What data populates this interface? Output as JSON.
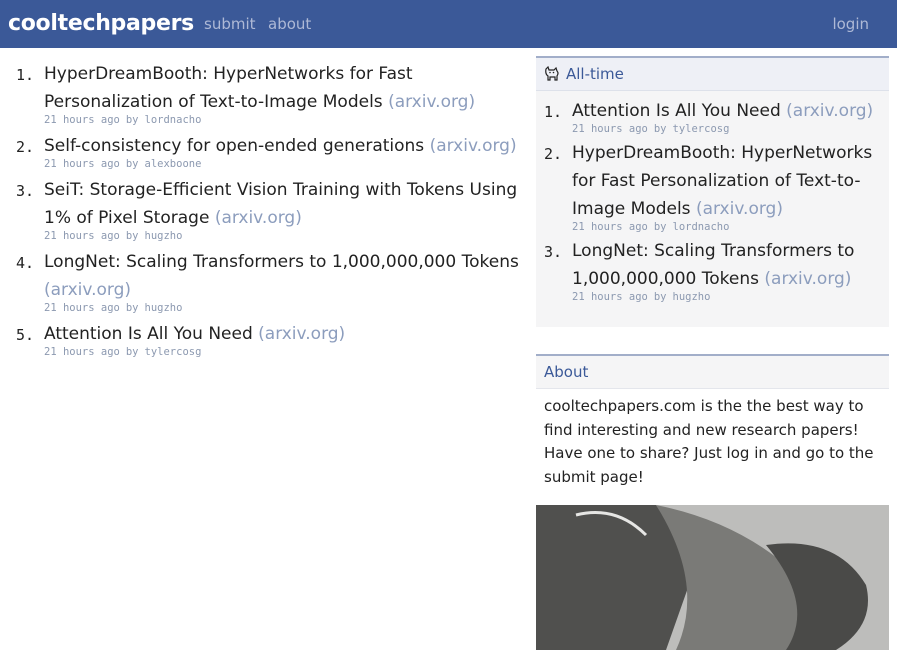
{
  "header": {
    "brand": "cooltechpapers",
    "nav": {
      "submit": "submit",
      "about": "about",
      "login": "login"
    }
  },
  "main": {
    "items": [
      {
        "num": "1.",
        "title": "HyperDreamBooth: HyperNetworks for Fast Personalization of Text-to-Image Models",
        "domain": "(arxiv.org)",
        "time": "21 hours ago",
        "by": "by",
        "user": "lordnacho"
      },
      {
        "num": "2.",
        "title": "Self-consistency for open-ended generations",
        "domain": "(arxiv.org)",
        "time": "21 hours ago",
        "by": "by",
        "user": "alexboone"
      },
      {
        "num": "3.",
        "title": "SeiT: Storage-Efficient Vision Training with Tokens Using 1% of Pixel Storage",
        "domain": "(arxiv.org)",
        "time": "21 hours ago",
        "by": "by",
        "user": "hugzho"
      },
      {
        "num": "4.",
        "title": "LongNet: Scaling Transformers to 1,000,000,000 Tokens",
        "domain": "(arxiv.org)",
        "time": "21 hours ago",
        "by": "by",
        "user": "hugzho"
      },
      {
        "num": "5.",
        "title": "Attention Is All You Need",
        "domain": "(arxiv.org)",
        "time": "21 hours ago",
        "by": "by",
        "user": "tylercosg"
      }
    ]
  },
  "sidebar": {
    "alltime": {
      "title": "All-time",
      "icon": "cat-icon",
      "items": [
        {
          "num": "1.",
          "title": "Attention Is All You Need",
          "domain": "(arxiv.org)",
          "time": "21 hours ago",
          "by": "by",
          "user": "tylercosg"
        },
        {
          "num": "2.",
          "title": "HyperDreamBooth: HyperNetworks for Fast Personalization of Text-to-Image Models",
          "domain": "(arxiv.org)",
          "time": "21 hours ago",
          "by": "by",
          "user": "lordnacho"
        },
        {
          "num": "3.",
          "title": "LongNet: Scaling Transformers to 1,000,000,000 Tokens",
          "domain": "(arxiv.org)",
          "time": "21 hours ago",
          "by": "by",
          "user": "hugzho"
        }
      ]
    },
    "about": {
      "title": "About",
      "text": "cooltechpapers.com is the the best way to find interesting and new research papers! Have one to share? Just log in and go to the submit page!"
    }
  },
  "colors": {
    "header_bg": "#3b5998",
    "link_muted": "#8c9dbd",
    "accent": "#a2aec9"
  }
}
